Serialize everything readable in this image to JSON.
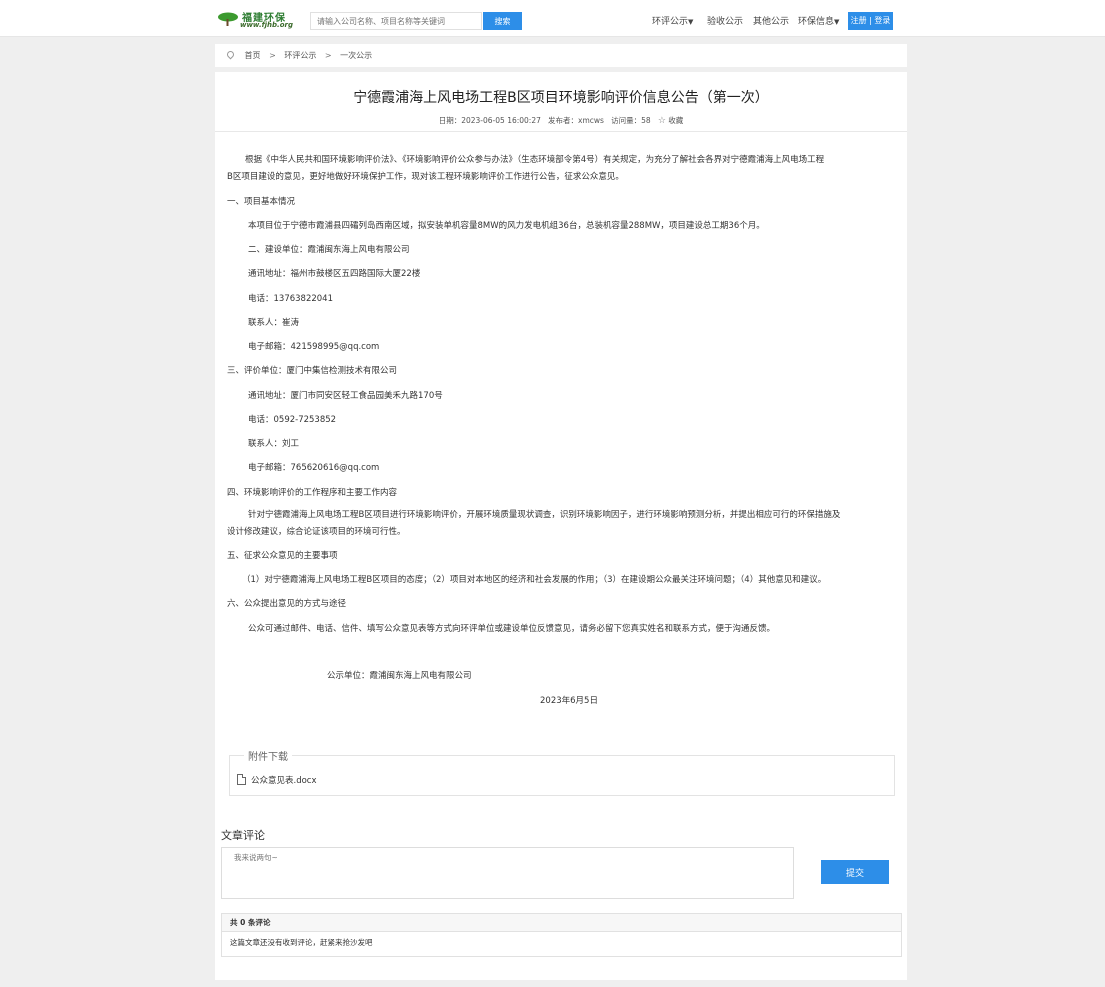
{
  "header": {
    "logo_brand": "福建环保",
    "logo_url": "www.fjhb.org",
    "search_placeholder": "请输入公司名称、项目名称等关键词",
    "search_button": "搜索",
    "nav": [
      {
        "label": "环评公示",
        "dropdown": true
      },
      {
        "label": "验收公示",
        "dropdown": false
      },
      {
        "label": "其他公示",
        "dropdown": false
      },
      {
        "label": "环保信息",
        "dropdown": true
      }
    ],
    "register": "注册",
    "login": "登录",
    "accent_color": "#2d8ee8"
  },
  "breadcrumb": [
    "首页",
    "环评公示",
    "一次公示"
  ],
  "article": {
    "title": "宁德霞浦海上风电场工程B区项目环境影响评价信息公告（第一次）",
    "date_label": "日期：",
    "date": "2023-06-05 16:00:27",
    "publisher_label": "发布者：",
    "publisher": "xmcws",
    "views_label": "访问量：",
    "views": "58",
    "favorite": "收藏",
    "paragraphs": [
      "根据《中华人民共和国环境影响评价法》、《环境影响评价公众参与办法》（生态环境部令第4号）有关规定，为充分了解社会各界对宁德霞浦海上风电场工程",
      "B区项目建设的意见，更好地做好环境保护工作，现对该工程环境影响评价工作进行公告，征求公众意见。",
      "一、项目基本情况",
      "本项目位于宁德市霞浦县四礵列岛西南区域，拟安装单机容量8MW的风力发电机组36台，总装机容量288MW，项目建设总工期36个月。",
      "二、建设单位：霞浦闽东海上风电有限公司",
      "通讯地址：福州市鼓楼区五四路国际大厦22楼",
      "电话：13763822041",
      "联系人：崔涛",
      "电子邮箱：421598995@qq.com",
      "三、评价单位：厦门中集信检测技术有限公司",
      "通讯地址：厦门市同安区轻工食品园美禾九路170号",
      "电话：0592-7253852",
      "联系人：刘工",
      "电子邮箱：765620616@qq.com",
      "四、环境影响评价的工作程序和主要工作内容",
      "针对宁德霞浦海上风电场工程B区项目进行环境影响评价，开展环境质量现状调查，识别环境影响因子，进行环境影响预测分析，并提出相应可行的环保措施及",
      "设计修改建议，综合论证该项目的环境可行性。",
      "五、征求公众意见的主要事项",
      "（1）对宁德霞浦海上风电场工程B区项目的态度；（2）项目对本地区的经济和社会发展的作用；（3）在建设期公众最关注环境问题；（4）其他意见和建议。",
      "六、公众提出意见的方式与途径",
      "公众可通过邮件、电话、信件、填写公众意见表等方式向环评单位或建设单位反馈意见，请务必留下您真实姓名和联系方式，便于沟通反馈。",
      "公示单位：霞浦闽东海上风电有限公司",
      "2023年6月5日"
    ]
  },
  "attachments": {
    "legend": "附件下载",
    "files": [
      "公众意见表.docx"
    ]
  },
  "comments": {
    "title": "文章评论",
    "placeholder": "我来说两句~",
    "submit": "提交",
    "count_label": "共 0 条评论",
    "empty_text": "这篇文章还没有收到评论，赶紧来抢沙发吧"
  }
}
